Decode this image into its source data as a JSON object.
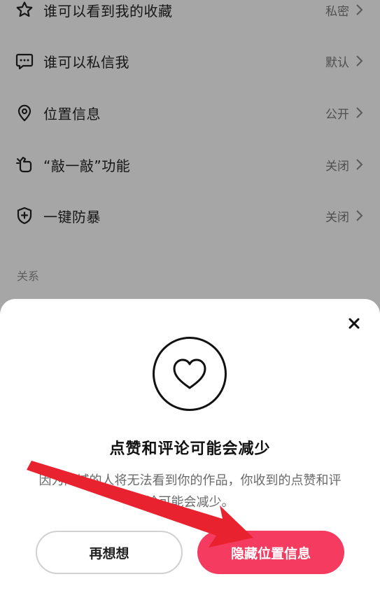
{
  "settings": {
    "rows": [
      {
        "label": "谁可以看到我的收藏",
        "value": "私密",
        "icon": "star-icon"
      },
      {
        "label": "谁可以私信我",
        "value": "默认",
        "icon": "message-icon"
      },
      {
        "label": "位置信息",
        "value": "公开",
        "icon": "location-pin-icon"
      },
      {
        "label": "“敲一敲”功能",
        "value": "关闭",
        "icon": "knock-hand-icon"
      },
      {
        "label": "一键防暴",
        "value": "关闭",
        "icon": "shield-plus-icon"
      }
    ],
    "section_title": "关系"
  },
  "dialog": {
    "title": "点赞和评论可能会减少",
    "description": "因为同城的人将无法看到你的作品，你收到的点赞和评论可能会减少。",
    "rethink_label": "再想想",
    "hide_label": "隐藏位置信息",
    "icon": "heart-icon"
  },
  "colors": {
    "accent": "#f53b5f",
    "annotation_arrow": "#e8232f",
    "overlay": "#a6a6a6"
  }
}
